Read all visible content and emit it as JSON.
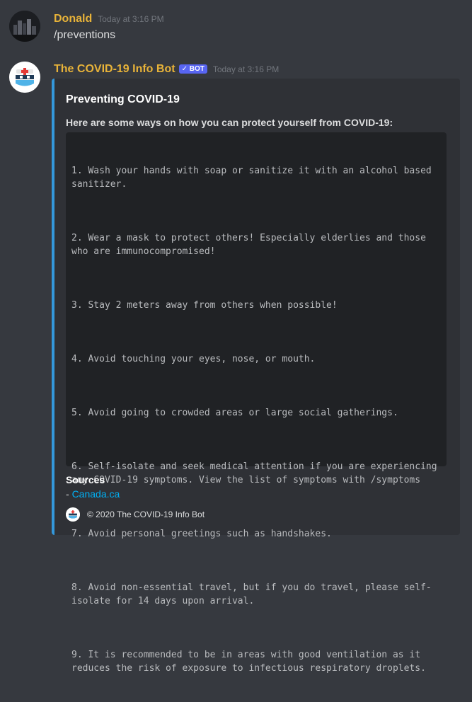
{
  "messages": [
    {
      "author": "Donald",
      "timestamp": "Today at 3:16 PM",
      "text": "/preventions"
    },
    {
      "author": "The COVID-19 Info Bot",
      "bot_tag": "✓ BOT",
      "timestamp": "Today at 3:16 PM",
      "embed": {
        "accent_color": "#3498db",
        "title": "Preventing COVID-19",
        "description": "Here are some ways on how you can protect yourself from COVID-19:",
        "items": [
          "1. Wash your hands with soap or sanitize it with an alcohol based sanitizer.",
          "2. Wear a mask to protect others! Especially elderlies and those who are immunocompromised!",
          "3. Stay 2 meters away from others when possible!",
          "4. Avoid touching your eyes, nose, or mouth.",
          "5. Avoid going to crowded areas or large social gatherings.",
          "6. Self-isolate and seek medical attention if you are experiencing any COVID-19 symptoms. View the list of symptoms with /symptoms",
          "7. Avoid personal greetings such as handshakes.",
          "8. Avoid non-essential travel, but if you do travel, please self-isolate for 14 days upon arrival.",
          "9. It is recommended to be in areas with good ventilation as it reduces the risk of exposure to infectious respiratory droplets."
        ],
        "field_name": "Sources",
        "field_prefix": "- ",
        "field_link": "Canada.ca",
        "footer": "© 2020 The COVID-19 Info Bot"
      }
    }
  ],
  "colors": {
    "username": "#e8b339",
    "link": "#00b0f4",
    "bot_tag": "#5865f2"
  },
  "icons": {
    "user_avatar": "dark-city-avatar",
    "bot_avatar": "medical-mask-bot-icon"
  }
}
